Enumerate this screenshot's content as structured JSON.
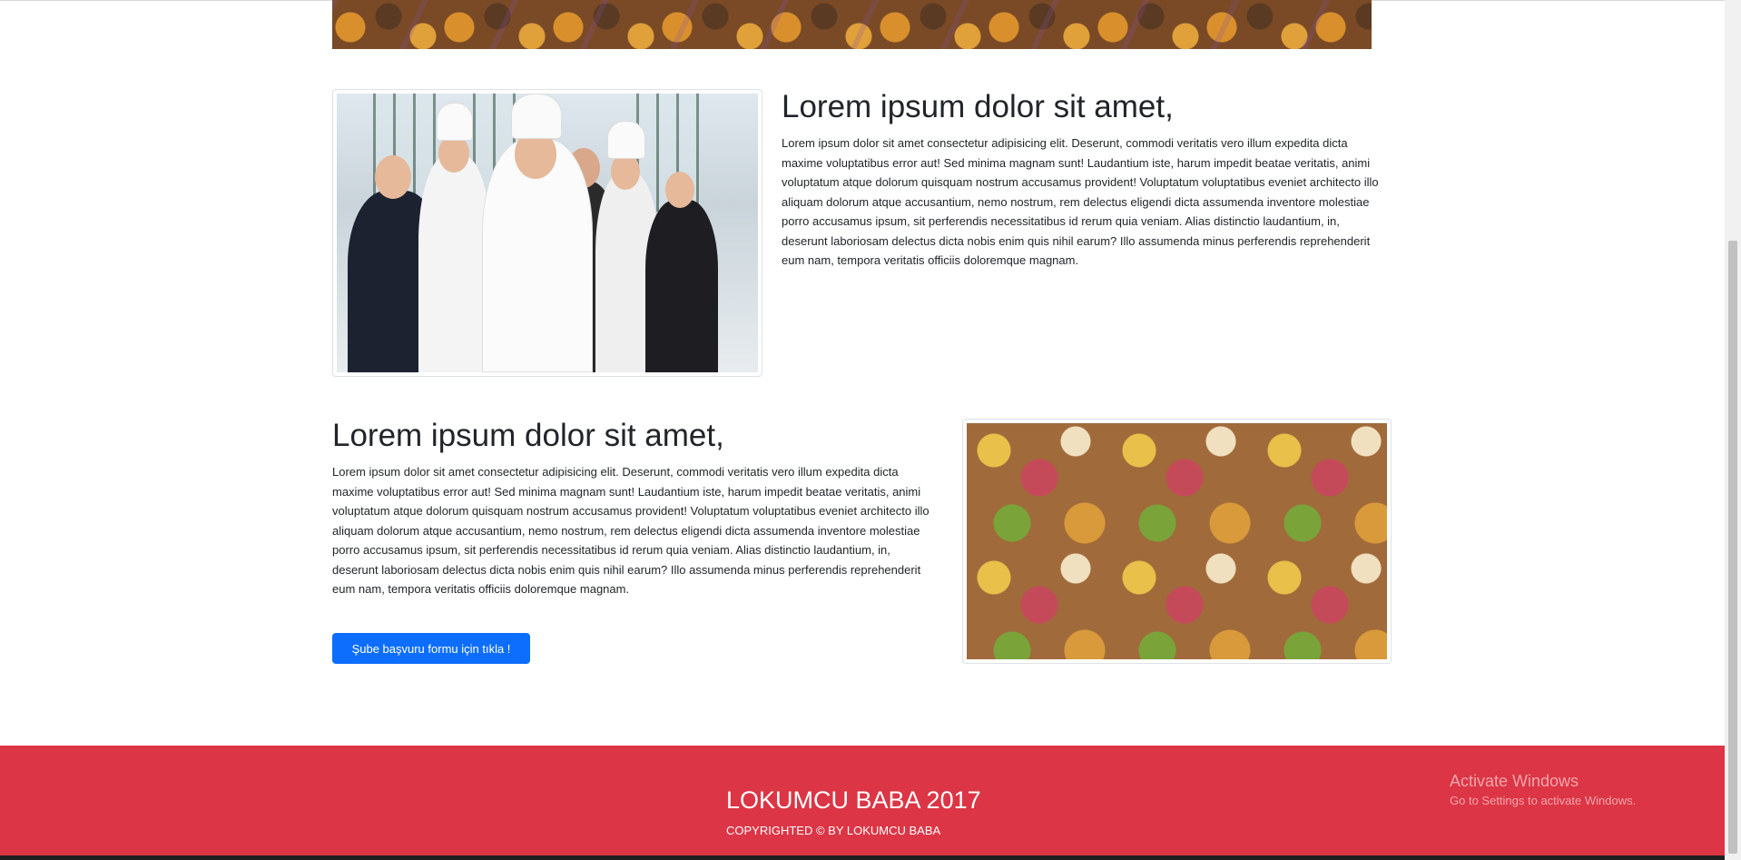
{
  "sections": [
    {
      "heading": "Lorem ipsum dolor sit amet,",
      "text": "Lorem ipsum dolor sit amet consectetur adipisicing elit. Deserunt, commodi veritatis vero illum expedita dicta maxime voluptatibus error aut! Sed minima magnam sunt! Laudantium iste, harum impedit beatae veritatis, animi voluptatum atque dolorum quisquam nostrum accusamus provident! Voluptatum voluptatibus eveniet architecto illo aliquam dolorum atque accusantium, nemo nostrum, rem delectus eligendi dicta assumenda inventore molestiae porro accusamus ipsum, sit perferendis necessitatibus id rerum quia veniam. Alias distinctio laudantium, in, deserunt laboriosam delectus dicta nobis enim quis nihil earum? Illo assumenda minus perferendis reprehenderit eum nam, tempora veritatis officiis doloremque magnam."
    },
    {
      "heading": "Lorem ipsum dolor sit amet,",
      "text": "Lorem ipsum dolor sit amet consectetur adipisicing elit. Deserunt, commodi veritatis vero illum expedita dicta maxime voluptatibus error aut! Sed minima magnam sunt! Laudantium iste, harum impedit beatae veritatis, animi voluptatum atque dolorum quisquam nostrum accusamus provident! Voluptatum voluptatibus eveniet architecto illo aliquam dolorum atque accusantium, nemo nostrum, rem delectus eligendi dicta assumenda inventore molestiae porro accusamus ipsum, sit perferendis necessitatibus id rerum quia veniam. Alias distinctio laudantium, in, deserunt laboriosam delectus dicta nobis enim quis nihil earum? Illo assumenda minus perferendis reprehenderit eum nam, tempora veritatis officiis doloremque magnam.",
      "button_label": "Şube başvuru formu için tıkla !"
    }
  ],
  "footer": {
    "title": "LOKUMCU BABA 2017",
    "copyright": "COPYRIGHTED © BY LOKUMCU BABA"
  },
  "watermark": {
    "title": "Activate Windows",
    "subtitle": "Go to Settings to activate Windows."
  },
  "colors": {
    "footer_bg": "#dc3545",
    "button_bg": "#0d6efd"
  }
}
